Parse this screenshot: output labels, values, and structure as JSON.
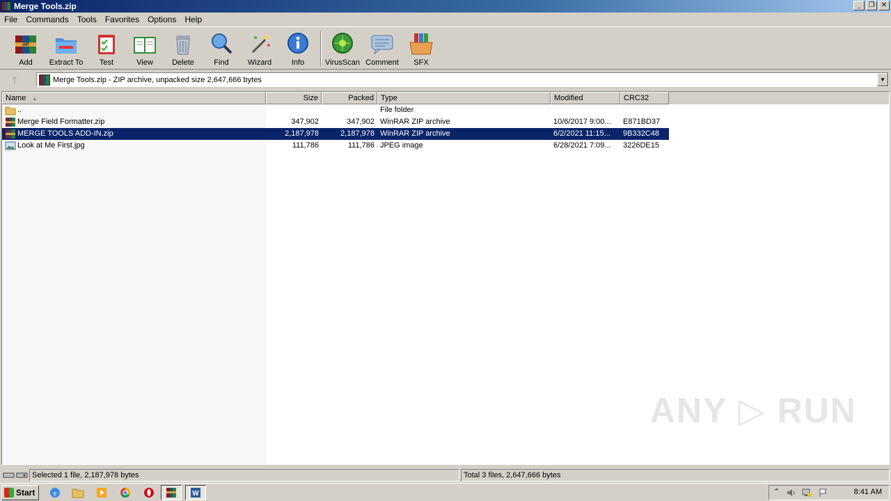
{
  "window": {
    "title": "Merge Tools.zip",
    "controls": [
      "_",
      "❐",
      "✕"
    ]
  },
  "menu": [
    "File",
    "Commands",
    "Tools",
    "Favorites",
    "Options",
    "Help"
  ],
  "toolbar": [
    {
      "label": "Add",
      "icon": "add-archive-icon"
    },
    {
      "label": "Extract To",
      "icon": "extract-folder-icon"
    },
    {
      "label": "Test",
      "icon": "test-clipboard-icon"
    },
    {
      "label": "View",
      "icon": "view-book-icon"
    },
    {
      "label": "Delete",
      "icon": "trash-icon"
    },
    {
      "label": "Find",
      "icon": "magnifier-icon"
    },
    {
      "label": "Wizard",
      "icon": "wand-icon"
    },
    {
      "label": "Info",
      "icon": "info-icon"
    },
    {
      "label": "VirusScan",
      "icon": "virus-scan-icon"
    },
    {
      "label": "Comment",
      "icon": "comment-icon"
    },
    {
      "label": "SFX",
      "icon": "sfx-box-icon"
    }
  ],
  "address": {
    "up_glyph": "🡑",
    "path": "Merge Tools.zip - ZIP archive, unpacked size 2,647,666 bytes",
    "dropdown": "▼"
  },
  "columns": {
    "name": "Name",
    "sort_arrow": "▲",
    "size": "Size",
    "packed": "Packed",
    "type": "Type",
    "modified": "Modified",
    "crc": "CRC32"
  },
  "files": [
    {
      "name": "..",
      "size": "",
      "packed": "",
      "type": "File folder",
      "modified": "",
      "crc": "",
      "icon": "folder-up-icon",
      "selected": false
    },
    {
      "name": "Merge Field Formatter.zip",
      "size": "347,902",
      "packed": "347,902",
      "type": "WinRAR ZIP archive",
      "modified": "10/6/2017 9:00...",
      "crc": "E871BD37",
      "icon": "zip-archive-icon",
      "selected": false
    },
    {
      "name": "MERGE TOOLS ADD-IN.zip",
      "size": "2,187,978",
      "packed": "2,187,978",
      "type": "WinRAR ZIP archive",
      "modified": "6/2/2021 11:15...",
      "crc": "9B332C48",
      "icon": "zip-archive-icon",
      "selected": true
    },
    {
      "name": "Look at Me First.jpg",
      "size": "111,786",
      "packed": "111,786",
      "type": "JPEG image",
      "modified": "6/28/2021 7:09...",
      "crc": "3226DE15",
      "icon": "image-file-icon",
      "selected": false
    }
  ],
  "watermark": "ANY ▷ RUN",
  "status": {
    "left": "Selected 1 file, 2,187,978 bytes",
    "right": "Total 3 files, 2,647,666 bytes"
  },
  "taskbar": {
    "start_label": "Start",
    "clock": "8:41 AM",
    "apps": [
      "ie-icon",
      "explorer-folder-icon",
      "media-player-icon",
      "chrome-icon",
      "opera-icon",
      "winrar-icon",
      "word-icon"
    ]
  }
}
